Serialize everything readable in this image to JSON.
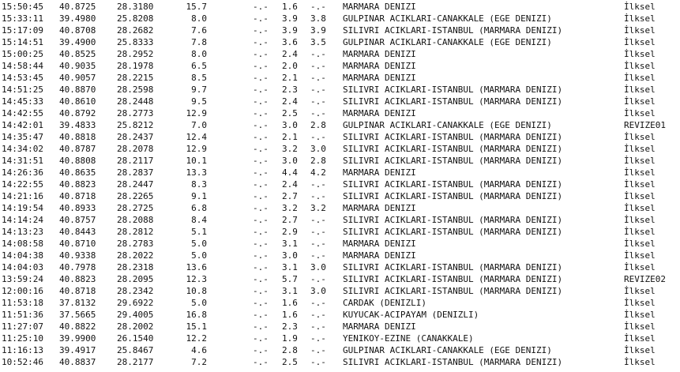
{
  "rows": [
    [
      "15:50:45",
      "40.8725",
      "28.3180",
      "15.7",
      "-.-",
      "1.6",
      "-.-",
      "MARMARA DENIZI",
      "İlksel"
    ],
    [
      "15:33:11",
      "39.4980",
      "25.8208",
      "8.0",
      "-.-",
      "3.9",
      "3.8",
      "GULPINAR ACIKLARI-CANAKKALE (EGE DENIZI)",
      "İlksel"
    ],
    [
      "15:17:09",
      "40.8708",
      "28.2682",
      "7.6",
      "-.-",
      "3.9",
      "3.9",
      "SILIVRI ACIKLARI-ISTANBUL (MARMARA DENIZI)",
      "İlksel"
    ],
    [
      "15:14:51",
      "39.4900",
      "25.8333",
      "7.8",
      "-.-",
      "3.6",
      "3.5",
      "GULPINAR ACIKLARI-CANAKKALE (EGE DENIZI)",
      "İlksel"
    ],
    [
      "15:00:25",
      "40.8525",
      "28.2952",
      "8.0",
      "-.-",
      "2.4",
      "-.-",
      "MARMARA DENIZI",
      "İlksel"
    ],
    [
      "14:58:44",
      "40.9035",
      "28.1978",
      "6.5",
      "-.-",
      "2.0",
      "-.-",
      "MARMARA DENIZI",
      "İlksel"
    ],
    [
      "14:53:45",
      "40.9057",
      "28.2215",
      "8.5",
      "-.-",
      "2.1",
      "-.-",
      "MARMARA DENIZI",
      "İlksel"
    ],
    [
      "14:51:25",
      "40.8870",
      "28.2598",
      "9.7",
      "-.-",
      "2.3",
      "-.-",
      "SILIVRI ACIKLARI-ISTANBUL (MARMARA DENIZI)",
      "İlksel"
    ],
    [
      "14:45:33",
      "40.8610",
      "28.2448",
      "9.5",
      "-.-",
      "2.4",
      "-.-",
      "SILIVRI ACIKLARI-ISTANBUL (MARMARA DENIZI)",
      "İlksel"
    ],
    [
      "14:42:55",
      "40.8792",
      "28.2773",
      "12.9",
      "-.-",
      "2.5",
      "-.-",
      "MARMARA DENIZI",
      "İlksel"
    ],
    [
      "14:42:01",
      "39.4833",
      "25.8212",
      "7.0",
      "-.-",
      "3.0",
      "2.8",
      "GULPINAR ACIKLARI-CANAKKALE (EGE DENIZI)",
      "REVIZE01"
    ],
    [
      "14:35:47",
      "40.8818",
      "28.2437",
      "12.4",
      "-.-",
      "2.1",
      "-.-",
      "SILIVRI ACIKLARI-ISTANBUL (MARMARA DENIZI)",
      "İlksel"
    ],
    [
      "14:34:02",
      "40.8787",
      "28.2078",
      "12.9",
      "-.-",
      "3.2",
      "3.0",
      "SILIVRI ACIKLARI-ISTANBUL (MARMARA DENIZI)",
      "İlksel"
    ],
    [
      "14:31:51",
      "40.8808",
      "28.2117",
      "10.1",
      "-.-",
      "3.0",
      "2.8",
      "SILIVRI ACIKLARI-ISTANBUL (MARMARA DENIZI)",
      "İlksel"
    ],
    [
      "14:26:36",
      "40.8635",
      "28.2837",
      "13.3",
      "-.-",
      "4.4",
      "4.2",
      "MARMARA DENIZI",
      "İlksel"
    ],
    [
      "14:22:55",
      "40.8823",
      "28.2447",
      "8.3",
      "-.-",
      "2.4",
      "-.-",
      "SILIVRI ACIKLARI-ISTANBUL (MARMARA DENIZI)",
      "İlksel"
    ],
    [
      "14:21:16",
      "40.8718",
      "28.2265",
      "9.1",
      "-.-",
      "2.7",
      "-.-",
      "SILIVRI ACIKLARI-ISTANBUL (MARMARA DENIZI)",
      "İlksel"
    ],
    [
      "14:19:54",
      "40.8933",
      "28.2725",
      "6.8",
      "-.-",
      "3.2",
      "3.2",
      "MARMARA DENIZI",
      "İlksel"
    ],
    [
      "14:14:24",
      "40.8757",
      "28.2088",
      "8.4",
      "-.-",
      "2.7",
      "-.-",
      "SILIVRI ACIKLARI-ISTANBUL (MARMARA DENIZI)",
      "İlksel"
    ],
    [
      "14:13:23",
      "40.8443",
      "28.2812",
      "5.1",
      "-.-",
      "2.9",
      "-.-",
      "SILIVRI ACIKLARI-ISTANBUL (MARMARA DENIZI)",
      "İlksel"
    ],
    [
      "14:08:58",
      "40.8710",
      "28.2783",
      "5.0",
      "-.-",
      "3.1",
      "-.-",
      "MARMARA DENIZI",
      "İlksel"
    ],
    [
      "14:04:38",
      "40.9338",
      "28.2022",
      "5.0",
      "-.-",
      "3.0",
      "-.-",
      "MARMARA DENIZI",
      "İlksel"
    ],
    [
      "14:04:03",
      "40.7978",
      "28.2318",
      "13.6",
      "-.-",
      "3.1",
      "3.0",
      "SILIVRI ACIKLARI-ISTANBUL (MARMARA DENIZI)",
      "İlksel"
    ],
    [
      "13:59:24",
      "40.8823",
      "28.2095",
      "12.3",
      "-.-",
      "5.7",
      "-.-",
      "SILIVRI ACIKLARI-ISTANBUL (MARMARA DENIZI)",
      "REVIZE02"
    ],
    [
      "12:00:16",
      "40.8718",
      "28.2342",
      "10.8",
      "-.-",
      "3.1",
      "3.0",
      "SILIVRI ACIKLARI-ISTANBUL (MARMARA DENIZI)",
      "İlksel"
    ],
    [
      "11:53:18",
      "37.8132",
      "29.6922",
      "5.0",
      "-.-",
      "1.6",
      "-.-",
      "CARDAK (DENIZLI)",
      "İlksel"
    ],
    [
      "11:51:36",
      "37.5665",
      "29.4005",
      "16.8",
      "-.-",
      "1.6",
      "-.-",
      "KUYUCAK-ACIPAYAM (DENIZLI)",
      "İlksel"
    ],
    [
      "11:27:07",
      "40.8822",
      "28.2002",
      "15.1",
      "-.-",
      "2.3",
      "-.-",
      "MARMARA DENIZI",
      "İlksel"
    ],
    [
      "11:25:10",
      "39.9900",
      "26.1540",
      "12.2",
      "-.-",
      "1.9",
      "-.-",
      "YENIKOY-EZINE (CANAKKALE)",
      "İlksel"
    ],
    [
      "11:16:13",
      "39.4917",
      "25.8467",
      "4.6",
      "-.-",
      "2.8",
      "-.-",
      "GULPINAR ACIKLARI-CANAKKALE (EGE DENIZI)",
      "İlksel"
    ],
    [
      "10:52:46",
      "40.8837",
      "28.2177",
      "7.2",
      "-.-",
      "2.5",
      "-.-",
      "SILIVRI ACIKLARI-ISTANBUL (MARMARA DENIZI)",
      "İlksel"
    ]
  ]
}
